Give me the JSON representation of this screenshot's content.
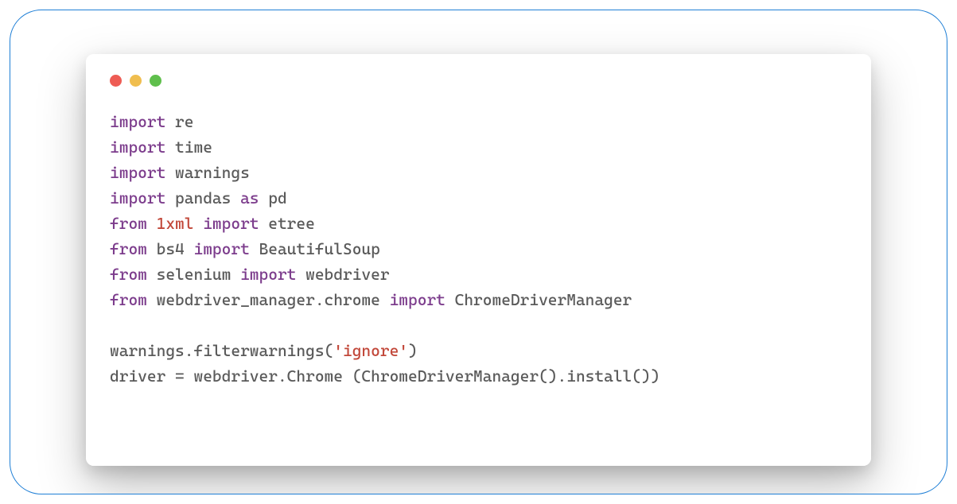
{
  "code": {
    "lines": [
      {
        "tokens": [
          {
            "t": "import",
            "c": "kw"
          },
          {
            "t": " re",
            "c": ""
          }
        ]
      },
      {
        "tokens": [
          {
            "t": "import",
            "c": "kw"
          },
          {
            "t": " time",
            "c": ""
          }
        ]
      },
      {
        "tokens": [
          {
            "t": "import",
            "c": "kw"
          },
          {
            "t": " warnings",
            "c": ""
          }
        ]
      },
      {
        "tokens": [
          {
            "t": "import",
            "c": "kw"
          },
          {
            "t": " pandas ",
            "c": ""
          },
          {
            "t": "as",
            "c": "kw"
          },
          {
            "t": " pd",
            "c": ""
          }
        ]
      },
      {
        "tokens": [
          {
            "t": "from",
            "c": "kw"
          },
          {
            "t": " ",
            "c": ""
          },
          {
            "t": "1xml",
            "c": "red"
          },
          {
            "t": " ",
            "c": ""
          },
          {
            "t": "import",
            "c": "kw"
          },
          {
            "t": " etree",
            "c": ""
          }
        ]
      },
      {
        "tokens": [
          {
            "t": "from",
            "c": "kw"
          },
          {
            "t": " bs4 ",
            "c": ""
          },
          {
            "t": "import",
            "c": "kw"
          },
          {
            "t": " BeautifulSoup",
            "c": ""
          }
        ]
      },
      {
        "tokens": [
          {
            "t": "from",
            "c": "kw"
          },
          {
            "t": " selenium ",
            "c": ""
          },
          {
            "t": "import",
            "c": "kw"
          },
          {
            "t": " webdriver",
            "c": ""
          }
        ]
      },
      {
        "tokens": [
          {
            "t": "from",
            "c": "kw"
          },
          {
            "t": " webdriver_manager.chrome ",
            "c": ""
          },
          {
            "t": "import",
            "c": "kw"
          },
          {
            "t": " ChromeDriverManager",
            "c": ""
          }
        ]
      },
      {
        "tokens": [
          {
            "t": "",
            "c": ""
          }
        ]
      },
      {
        "tokens": [
          {
            "t": "warnings.filterwarnings(",
            "c": ""
          },
          {
            "t": "'ignore'",
            "c": "red"
          },
          {
            "t": ")",
            "c": ""
          }
        ]
      },
      {
        "tokens": [
          {
            "t": "driver = webdriver.Chrome (ChromeDriverManager().install())",
            "c": ""
          }
        ]
      }
    ]
  },
  "window": {
    "traffic_colors": {
      "red": "#ee5c54",
      "yellow": "#f0be4f",
      "green": "#5fbf4c"
    }
  }
}
